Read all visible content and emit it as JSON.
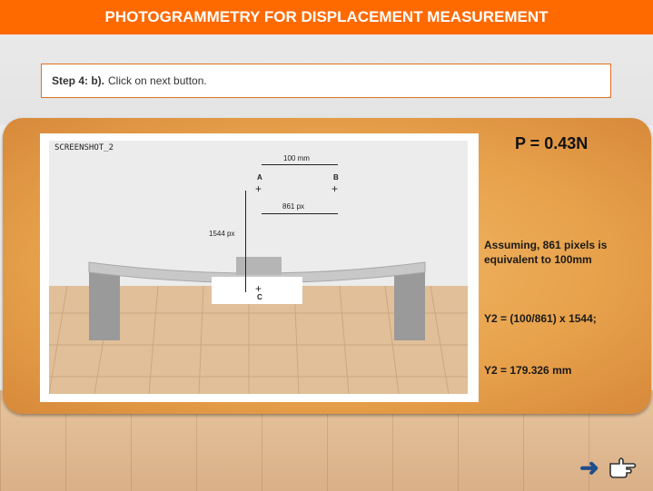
{
  "header": {
    "title": "PHOTOGRAMMETRY FOR DISPLACEMENT MEASUREMENT"
  },
  "step": {
    "prefix": "Step 4: b).",
    "text": "Click on next button."
  },
  "photo": {
    "screenshot_label": "SCREENSHOT_2",
    "distance_mm": "100 mm",
    "point_a": "A",
    "point_b": "B",
    "point_c": "C",
    "distance_px": "861 px",
    "vertical_px": "1544 px"
  },
  "results": {
    "load": "P = 0.43N",
    "assumption": "Assuming, 861 pixels is equivalent to 100mm",
    "formula": "Y2 = (100/861) x 1544;",
    "result": "Y2 = 179.326 mm"
  },
  "nav": {
    "next_icon": "arrow-right-icon",
    "pointer_icon": "pointing-hand-icon"
  },
  "colors": {
    "header": "#ff6a00",
    "board": "#e7a14b",
    "arrow": "#1e4e8c"
  }
}
